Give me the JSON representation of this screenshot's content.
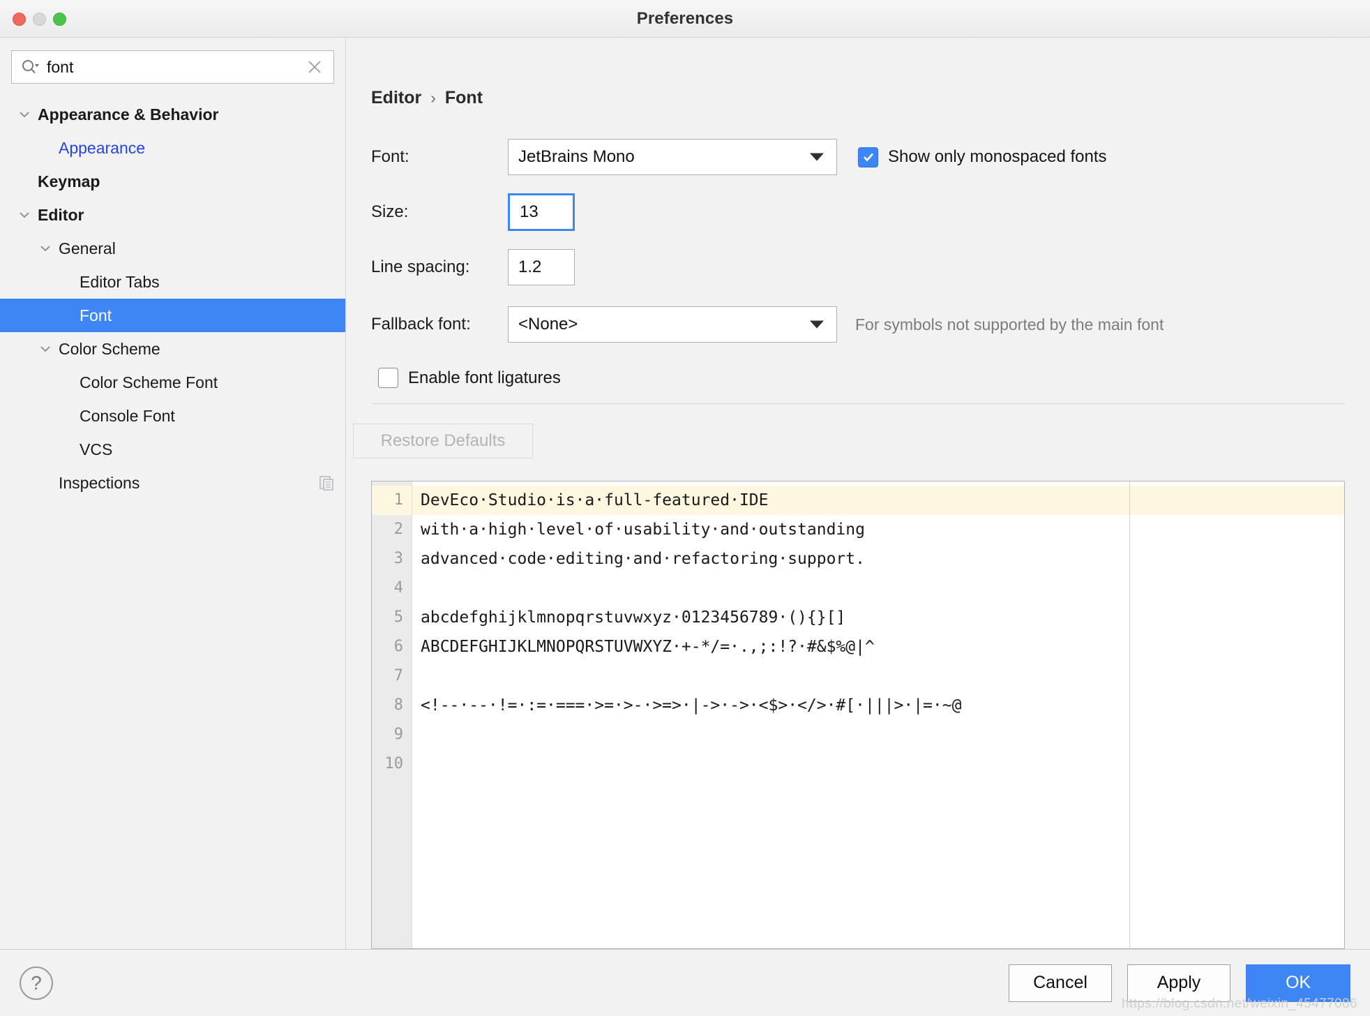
{
  "window": {
    "title": "Preferences",
    "traffic_lights": [
      "close-red",
      "minimize-yellow",
      "maximize-green"
    ]
  },
  "search": {
    "value": "font",
    "placeholder": "",
    "icon": "search-icon",
    "clear_icon": "close-icon"
  },
  "sidebar": {
    "items": [
      {
        "label": "Appearance & Behavior",
        "indent": 0,
        "chevron": "down",
        "bold": true,
        "selected": false,
        "link": false
      },
      {
        "label": "Appearance",
        "indent": 1,
        "chevron": "none",
        "bold": false,
        "selected": false,
        "link": true
      },
      {
        "label": "Keymap",
        "indent": 0,
        "chevron": "none",
        "bold": true,
        "selected": false,
        "link": false
      },
      {
        "label": "Editor",
        "indent": 0,
        "chevron": "down",
        "bold": true,
        "selected": false,
        "link": false
      },
      {
        "label": "General",
        "indent": 1,
        "chevron": "down",
        "bold": false,
        "selected": false,
        "link": false
      },
      {
        "label": "Editor Tabs",
        "indent": 2,
        "chevron": "none",
        "bold": false,
        "selected": false,
        "link": false
      },
      {
        "label": "Font",
        "indent": 2,
        "chevron": "none",
        "bold": false,
        "selected": true,
        "link": false
      },
      {
        "label": "Color Scheme",
        "indent": 1,
        "chevron": "down",
        "bold": false,
        "selected": false,
        "link": false
      },
      {
        "label": "Color Scheme Font",
        "indent": 2,
        "chevron": "none",
        "bold": false,
        "selected": false,
        "link": false
      },
      {
        "label": "Console Font",
        "indent": 2,
        "chevron": "none",
        "bold": false,
        "selected": false,
        "link": false
      },
      {
        "label": "VCS",
        "indent": 2,
        "chevron": "none",
        "bold": false,
        "selected": false,
        "link": false
      },
      {
        "label": "Inspections",
        "indent": 1,
        "chevron": "none",
        "bold": false,
        "selected": false,
        "link": false,
        "trailing_icon": "copy-icon"
      }
    ]
  },
  "breadcrumb": {
    "parent": "Editor",
    "separator": "›",
    "current": "Font"
  },
  "form": {
    "font_label": "Font:",
    "font_value": "JetBrains Mono",
    "monospaced_checkbox_label": "Show only monospaced fonts",
    "monospaced_checked": true,
    "size_label": "Size:",
    "size_value": "13",
    "line_spacing_label": "Line spacing:",
    "line_spacing_value": "1.2",
    "fallback_label": "Fallback font:",
    "fallback_value": "<None>",
    "fallback_hint": "For symbols not supported by the main font",
    "ligatures_label": "Enable font ligatures",
    "ligatures_checked": false,
    "restore_defaults_label": "Restore Defaults",
    "restore_defaults_enabled": false
  },
  "preview": {
    "line_numbers": [
      "1",
      "2",
      "3",
      "4",
      "5",
      "6",
      "7",
      "8",
      "9",
      "10"
    ],
    "current_line": 1,
    "lines": [
      "DevEco Studio is a full-featured IDE",
      "with a high level of usability and outstanding",
      "advanced code editing and refactoring support.",
      "",
      "abcdefghijklmnopqrstuvwxyz 0123456789 (){}[]",
      "ABCDEFGHIJKLMNOPQRSTUVWXYZ +-*/= .,;:!? #&$%@|^",
      "",
      "<!-- -- != := === >= >- >=> |-> -> <$> </> #[ |||> |= ~@",
      "",
      ""
    ]
  },
  "footer": {
    "help_label": "?",
    "cancel_label": "Cancel",
    "apply_label": "Apply",
    "ok_label": "OK",
    "watermark": "https://blog.csdn.net/weixin_45477086"
  },
  "colors": {
    "accent": "#3d86f4",
    "selection": "#3d86f4",
    "link": "#2743e6",
    "current_line": "#fdf7e0",
    "window_bg": "#f2f2f2"
  }
}
